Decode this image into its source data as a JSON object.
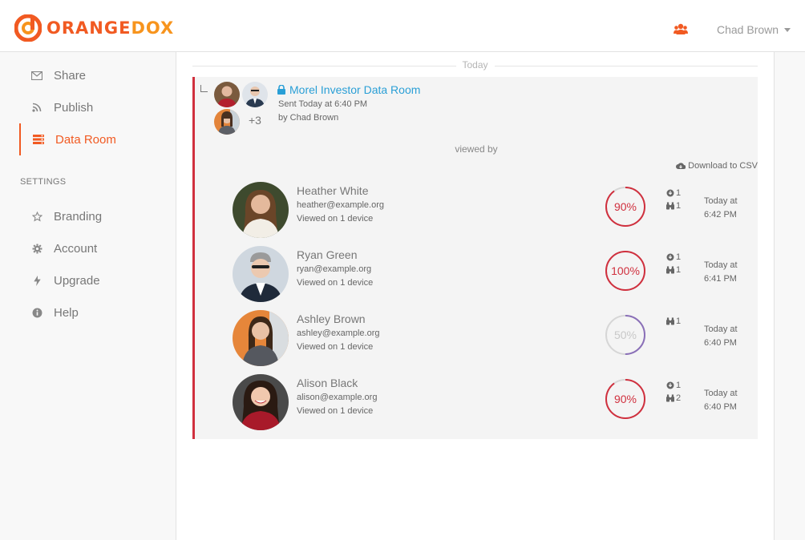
{
  "header": {
    "logo_part1": "ORANGE",
    "logo_part2": "DOX",
    "user_name": "Chad Brown",
    "brand_color": "#f15a22",
    "brand_color_secondary": "#f7941d"
  },
  "sidebar": {
    "items": [
      {
        "label": "Share",
        "icon": "envelope-icon"
      },
      {
        "label": "Publish",
        "icon": "rss-icon"
      },
      {
        "label": "Data Room",
        "icon": "server-icon",
        "active": true
      }
    ],
    "settings_label": "SETTINGS",
    "settings_items": [
      {
        "label": "Branding",
        "icon": "star-icon"
      },
      {
        "label": "Account",
        "icon": "gear-icon"
      },
      {
        "label": "Upgrade",
        "icon": "bolt-icon"
      },
      {
        "label": "Help",
        "icon": "info-icon"
      }
    ]
  },
  "feed": {
    "day_label": "Today",
    "share": {
      "title": "Morel Investor Data Room",
      "sent": "Sent Today at 6:40 PM",
      "by": "by Chad Brown",
      "more_count": "+3",
      "viewed_by_label": "viewed by",
      "download_label": "Download to CSV",
      "accent_color": "#d0303e",
      "link_color": "#2a9fd6"
    },
    "viewers": [
      {
        "name": "Heather White",
        "email": "heather@example.org",
        "devices": "Viewed on 1 device",
        "percent_label": "90%",
        "percent": 0.9,
        "downloads": "1",
        "views": "1",
        "time_line1": "Today at",
        "time_line2": "6:42 PM",
        "ring_color": "#d0303e"
      },
      {
        "name": "Ryan Green",
        "email": "ryan@example.org",
        "devices": "Viewed on 1 device",
        "percent_label": "100%",
        "percent": 1.0,
        "downloads": "1",
        "views": "1",
        "time_line1": "Today at",
        "time_line2": "6:41 PM",
        "ring_color": "#d0303e"
      },
      {
        "name": "Ashley Brown",
        "email": "ashley@example.org",
        "devices": "Viewed on 1 device",
        "percent_label": "50%",
        "percent": 0.5,
        "downloads": "",
        "views": "1",
        "time_line1": "Today at",
        "time_line2": "6:40 PM",
        "ring_color": "#8a6fb8"
      },
      {
        "name": "Alison Black",
        "email": "alison@example.org",
        "devices": "Viewed on 1 device",
        "percent_label": "90%",
        "percent": 0.9,
        "downloads": "1",
        "views": "2",
        "time_line1": "Today at",
        "time_line2": "6:40 PM",
        "ring_color": "#d0303e"
      }
    ]
  }
}
